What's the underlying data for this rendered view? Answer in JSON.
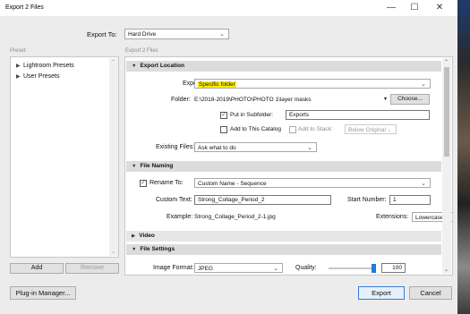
{
  "window": {
    "title": "Export 2 Files",
    "minimize": "—",
    "maximize": "☐",
    "close": "✕"
  },
  "export_to": {
    "label": "Export To:",
    "value": "Hard Drive"
  },
  "preset": {
    "label": "Preset:",
    "items": [
      {
        "label": "Lightroom Presets",
        "icon": "triangle-right"
      },
      {
        "label": "User Presets",
        "icon": "triangle-right"
      }
    ],
    "add_label": "Add",
    "remove_label": "Remove"
  },
  "breadcrumb": "Export 2 Files",
  "export_location": {
    "header": "Export Location",
    "export_to_label": "Export To:",
    "export_to_value": "Specific folder",
    "folder_label": "Folder:",
    "folder_path": "E:\\2018-2019\\PHOTO\\PHOTO 1\\layer masks",
    "choose_label": "Choose...",
    "put_in_subfolder_label": "Put in Subfolder:",
    "put_in_subfolder_checked": true,
    "subfolder_value": "Exports",
    "add_to_catalog_label": "Add to This Catalog",
    "add_to_catalog_checked": false,
    "add_to_stack_label": "Add to Stack:",
    "add_to_stack_value": "Below Original",
    "existing_files_label": "Existing Files:",
    "existing_files_value": "Ask what to do"
  },
  "file_naming": {
    "header": "File Naming",
    "rename_to_label": "Rename To:",
    "rename_to_checked": true,
    "rename_to_value": "Custom Name - Sequence",
    "custom_text_label": "Custom Text:",
    "custom_text_value": "Strong_Collage_Period_2",
    "start_number_label": "Start Number:",
    "start_number_value": "1",
    "example_label": "Example:",
    "example_value": "Strong_Collage_Period_2-1.jpg",
    "extensions_label": "Extensions:",
    "extensions_value": "Lowercase"
  },
  "video": {
    "header": "Video"
  },
  "file_settings": {
    "header": "File Settings",
    "image_format_label": "Image Format:",
    "image_format_value": "JPEG",
    "quality_label": "Quality:",
    "quality_value": "100",
    "quality_fraction": 1.0
  },
  "footer": {
    "plugin_manager_label": "Plug-in Manager...",
    "export_label": "Export",
    "cancel_label": "Cancel"
  },
  "colors": {
    "accent": "#1e7ae0",
    "highlight": "#ffee00"
  }
}
